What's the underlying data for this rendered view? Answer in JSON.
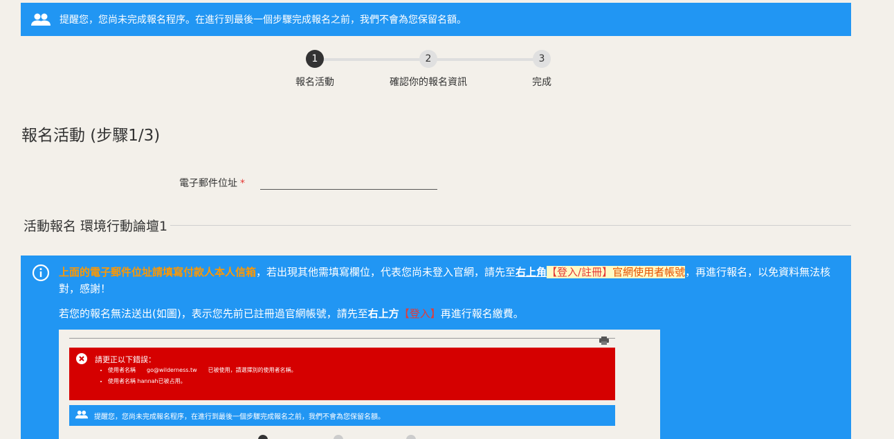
{
  "notice": {
    "text": "提醒您，您尚未完成報名程序。在進行到最後一個步驟完成報名之前，我們不會為您保留名額。",
    "icon": "users-icon"
  },
  "steps": [
    {
      "num": "1",
      "label": "報名活動",
      "active": true
    },
    {
      "num": "2",
      "label": "確認你的報名資訊",
      "active": false
    },
    {
      "num": "3",
      "label": "完成",
      "active": false
    }
  ],
  "page_title": "報名活動 (步驟1/3)",
  "email": {
    "label": "電子郵件位址",
    "required_mark": "*",
    "value": ""
  },
  "section_title": "活動報名 環境行動論壇1",
  "info": {
    "p1_orange": "上面的電子郵件位址請填寫付款人本人信箱",
    "p1_a": "，若出現其他需填寫欄位，代表您尚未登入官網，請先至",
    "p1_underline": "右上角",
    "p1_hl_red": "【登入/註冊】",
    "p1_hl_rest": "官網使用者帳號",
    "p1_b": "，再進行報名，以免資料無法核對，感謝！",
    "p2_a": "若您的報名無法送出(如圖)，表示您先前已註冊過官網帳號，請先至",
    "p2_bold": "右上方",
    "p2_red": "【登入】",
    "p2_b": "再進行報名繳費。"
  },
  "embed": {
    "error_title": "請更正以下錯誤：",
    "error_items": [
      "使用者名稱　　go@wilderness.tw　　已被使用，請選擇別的使用者名稱。",
      "使用者名稱 hannah已被占用。"
    ],
    "notice_text": "提醒您，您尚未完成報名程序，在進行到最後一個步驟完成報名之前，我們不會為您保留名額。"
  },
  "colors": {
    "primary": "#2196f3",
    "error": "#d50000",
    "accent": "#ff9800",
    "background": "#f3f0ea"
  }
}
